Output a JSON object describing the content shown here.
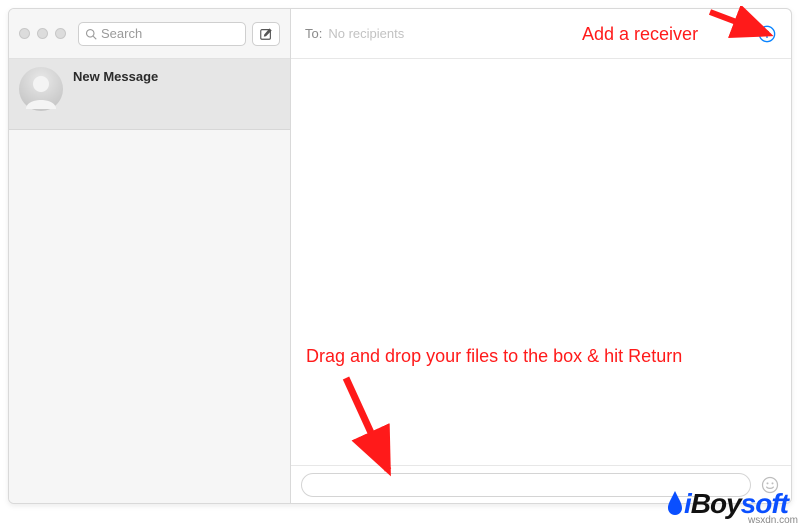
{
  "sidebar": {
    "search_placeholder": "Search",
    "items": [
      {
        "title": "New Message"
      }
    ]
  },
  "to_bar": {
    "label": "To:",
    "placeholder": "No recipients"
  },
  "annotations": {
    "add_receiver": "Add a receiver",
    "drag_drop": "Drag and drop your files to the box & hit Return"
  },
  "watermark": {
    "i": "i",
    "boy": "Boy",
    "soft": "soft"
  },
  "colors": {
    "annotation_red": "#ff1a1a",
    "brand_blue": "#0a4fff",
    "brand_black": "#111111",
    "add_button_blue": "#0a84ff"
  },
  "source": "wsxdn.com"
}
